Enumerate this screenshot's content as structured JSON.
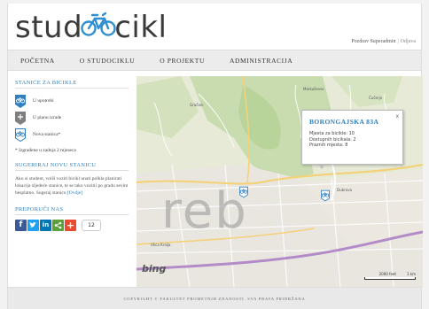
{
  "header": {
    "logo_left": "stud",
    "logo_right": "cikl",
    "user_label": "Pozdrav Superadmin",
    "logout_label": "Odjava"
  },
  "nav": {
    "items": [
      "POČETNA",
      "O STUDOCIKLU",
      "O PROJEKTU",
      "ADMINISTRACIJA"
    ]
  },
  "sidebar": {
    "stations_title": "STANICE ZA BICIKLE",
    "legend": [
      {
        "label": "U upotrebi",
        "color": "#2f7fc3"
      },
      {
        "label": "U planu izrade",
        "color": "#7f7f7f"
      },
      {
        "label": "Nova stanica*",
        "color": "#2f7fc3"
      }
    ],
    "note": "* Izgrađene u zadnja 2 mjeseca",
    "suggest_title": "SUGERIRAJ NOVU STANICU",
    "suggest_text": "Ako si student, voliš voziti bicikl unati polkla planirati lokacija sljedeće stanice, te se tako vozitii po gradu sevim besplatno. Sugeraj stanicu",
    "suggest_link": "[Ovdje]",
    "share_title": "PREPORUČI NAS",
    "share_count": "12",
    "social_colors": {
      "facebook": "#3b5998",
      "twitter": "#1da1f2",
      "linkedin": "#0077b5",
      "share": "#5aa13a",
      "plus": "#e94b2f"
    }
  },
  "map": {
    "popup_title": "BORONGAJSKA 83A",
    "popup_lines": [
      "Mjesta za bicikle: 10",
      "Dostupnih bicikala: 2",
      "Praznih mjesta: 8"
    ],
    "popup_close": "x",
    "city_label": "reb",
    "bing_label": "bing",
    "scale_left": "2000 feet",
    "scale_right": "1 km"
  },
  "footer": {
    "text": "COPYRIGHT © FAKULTET PROMETNIH ZNANOSTI. SVA PRAVA PRIDRŽANA"
  }
}
